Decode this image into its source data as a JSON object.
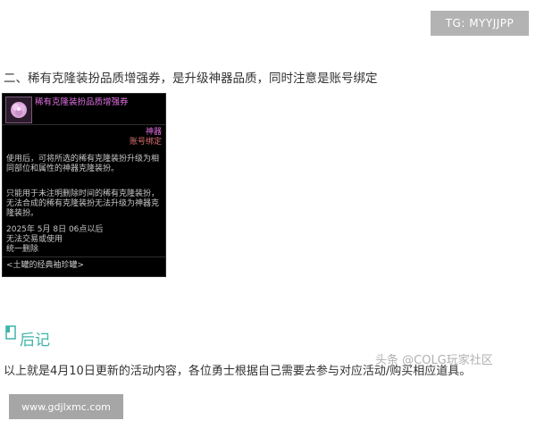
{
  "badges": {
    "tg": "TG: MYYJJPP",
    "site": "www.gdjlxmc.com"
  },
  "section": {
    "title": "二、稀有克隆装扮品质增强券，是升级神器品质，同时注意是账号绑定"
  },
  "item_card": {
    "icon": "pink-flower-coupon-icon",
    "name": "稀有克隆装扮品质增强券",
    "grade": "神器",
    "binding": "账号绑定",
    "desc_1": "使用后，可将所选的稀有克隆装扮升级为相同部位和属性的神器克隆装扮。",
    "desc_2": "只能用于未注明删除时间的稀有克隆装扮，无法合成的稀有克隆装扮无法升级为神器克隆装扮。",
    "date_line": "2025年 5月 8日 06点以后",
    "trade_line": "无法交易或使用",
    "delete_line": "统一删除",
    "set_line": "<土罐的经典袖珍罐>"
  },
  "postscript": {
    "icon": "bookmark-icon",
    "title": "后记",
    "summary": "以上就是4月10日更新的活动内容，各位勇士根据自己需要去参与对应活动/购买相应道具。"
  },
  "watermark": "头条 @COLG玩家社区",
  "colors": {
    "accent": "#3fb4a8",
    "item_name": "#e070e0",
    "binding": "#e07070",
    "badge_bg": "#b3b3b3"
  }
}
